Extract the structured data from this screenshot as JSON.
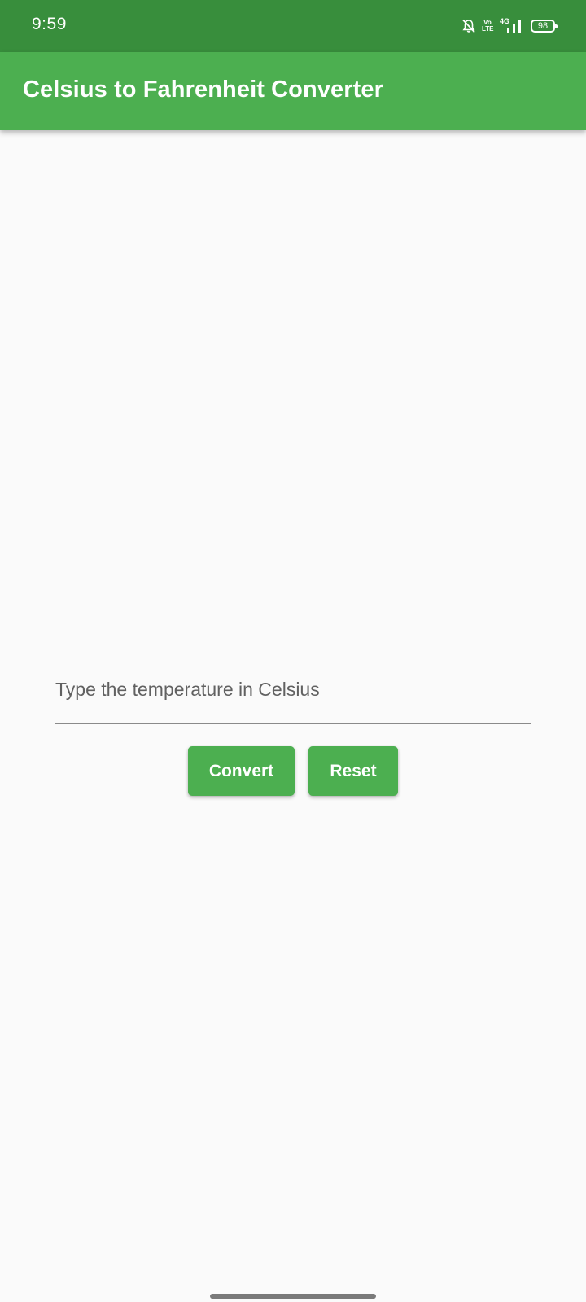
{
  "status_bar": {
    "time": "9:59",
    "icons": [
      "bell-off-icon",
      "volte-icon",
      "network-4g-icon",
      "signal-icon",
      "battery-icon"
    ],
    "volte_top": "Vo",
    "volte_bottom": "LTE",
    "network_label": "4G",
    "battery_level": "98"
  },
  "app_bar": {
    "title": "Celsius to Fahrenheit Converter"
  },
  "form": {
    "input_placeholder": "Type the temperature in Celsius",
    "input_value": "",
    "convert_label": "Convert",
    "reset_label": "Reset"
  },
  "colors": {
    "status_bar": "#388e3c",
    "primary": "#4caf50",
    "background": "#fafafa"
  }
}
